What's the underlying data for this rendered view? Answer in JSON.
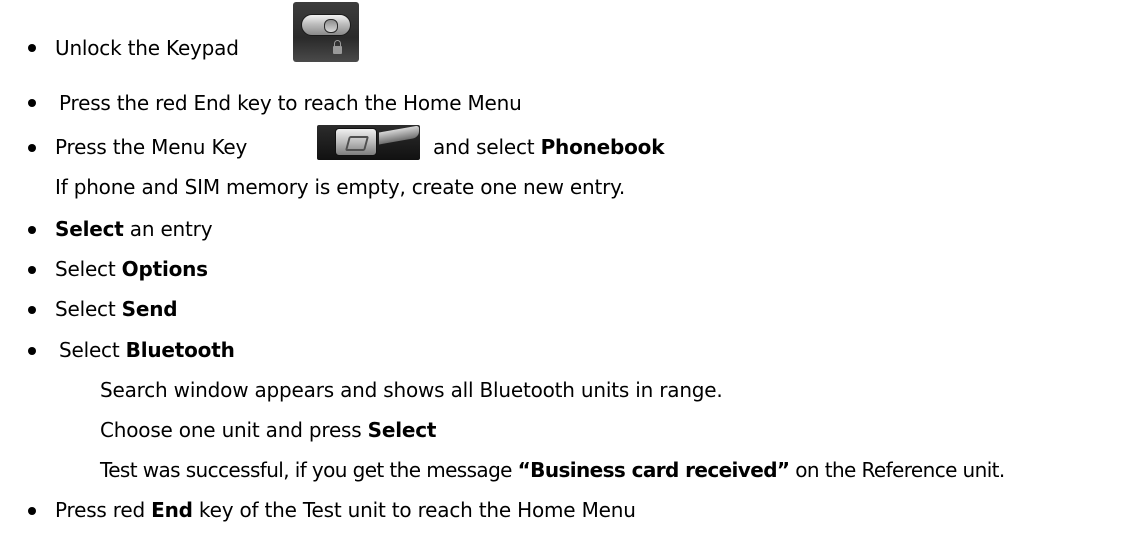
{
  "steps": [
    {
      "text": "Unlock the Keypad",
      "icon": "keypad-lock-icon"
    },
    {
      "text": "Press the red End key to reach the Home Menu"
    },
    {
      "pre": "Press the Menu Key",
      "post": "and select ",
      "bold": "Phonebook",
      "icon": "menu-key-icon"
    },
    {
      "note": "If phone and SIM memory is empty, create one new entry."
    },
    {
      "bold": "Select",
      "post": " an entry"
    },
    {
      "pre": "Select ",
      "bold": "Options"
    },
    {
      "pre": "Select ",
      "bold": "Send"
    },
    {
      "pre": "Select ",
      "bold": "Bluetooth"
    },
    {
      "note": "Search window appears and shows all Bluetooth units in range."
    },
    {
      "pre": "Choose one unit and press ",
      "bold": "Select"
    },
    {
      "pre": "Test was successful, if you get the message ",
      "bold": "“Business card received”",
      "post": " on the Reference unit."
    },
    {
      "pre": "Press red ",
      "bold": "End",
      "post": " key of the Test unit to reach the Home Menu"
    }
  ]
}
